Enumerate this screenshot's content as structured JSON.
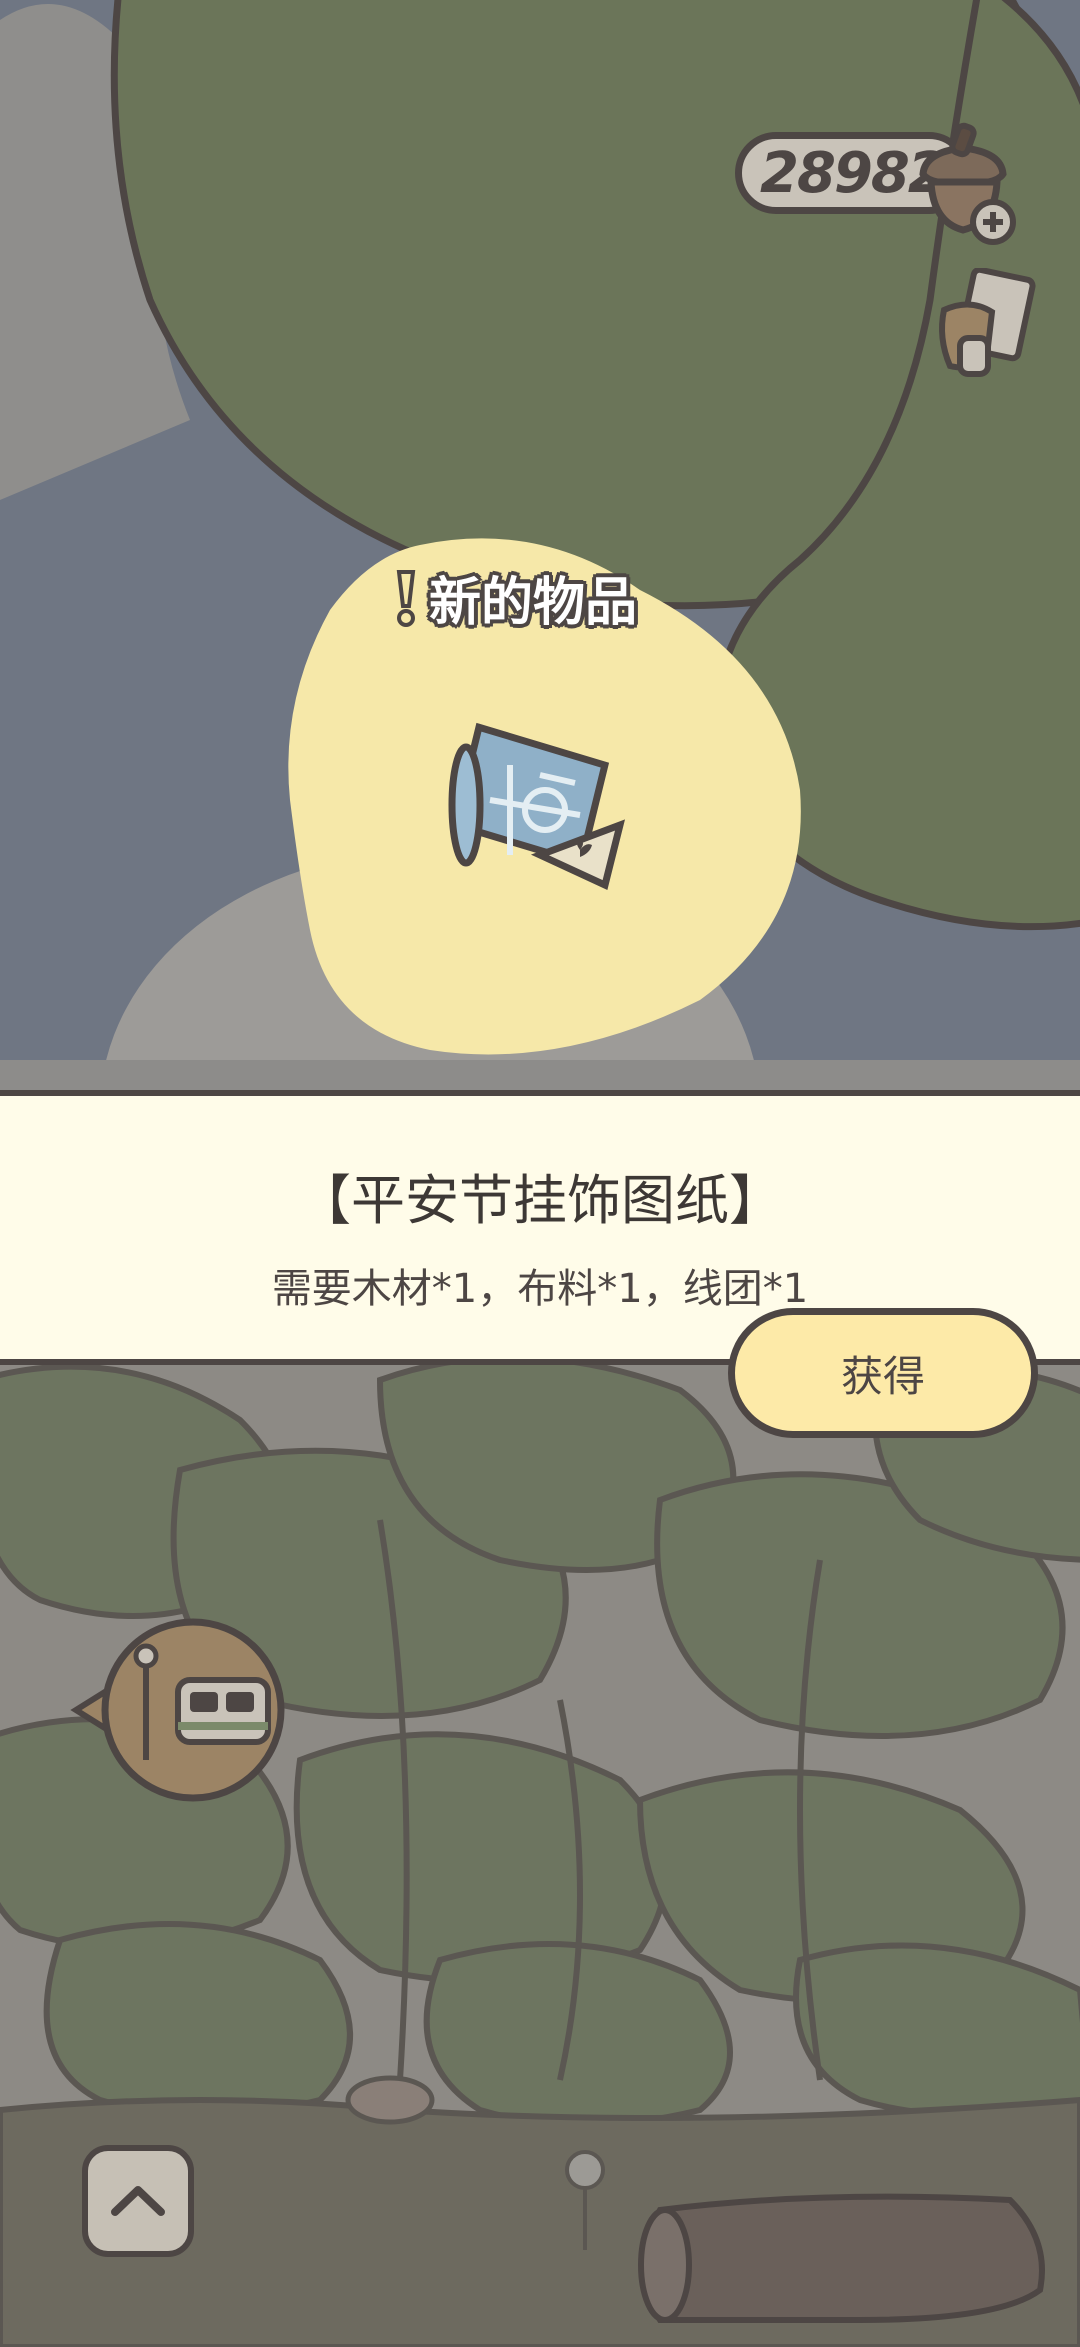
{
  "hud": {
    "currency_count": "289828",
    "currency_icon": "acorn-icon",
    "add_icon": "plus-icon",
    "note_icon": "note-icon"
  },
  "popup": {
    "badge": "新的物品",
    "item_icon": "blueprint-icon",
    "item_name": "【平安节挂饰图纸】",
    "requirements": "需要木材*1，布料*1，线团*1",
    "get_button": "获得"
  },
  "controls": {
    "bus_icon": "bus-stop-icon",
    "up_icon": "chevron-up-icon"
  },
  "colors": {
    "outline": "#4d4644",
    "panel_bg": "#fffce9",
    "button_bg": "#fdeaa8",
    "highlight": "#f6e8a9",
    "leaf": "#6b7559",
    "sky": "#6f7683"
  }
}
